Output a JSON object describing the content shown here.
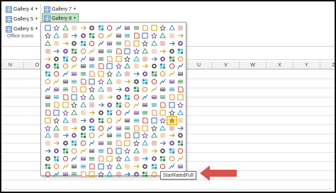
{
  "ribbon": {
    "gallery4": "Gallery 4",
    "gallery5": "Gallery 5",
    "gallery6": "Gallery 6",
    "gallery7": "Gallery 7",
    "gallery8": "Gallery 8",
    "group_label": "Office Icons"
  },
  "columns": [
    "N",
    "O",
    "P",
    "Q",
    "R",
    "S",
    "T",
    "U",
    "V",
    "W",
    "X",
    "Y",
    "Z"
  ],
  "gallery": {
    "selected_index": 206,
    "tooltip": "StarRatedFull",
    "accent": "#e0a000"
  },
  "colors": {
    "accent_arrow": "#d9534f",
    "selected_button": "#c7e5c9"
  },
  "icon_names": {
    "selected": "star-rated-full-icon",
    "ribbon_gallery": "gallery-icon"
  }
}
